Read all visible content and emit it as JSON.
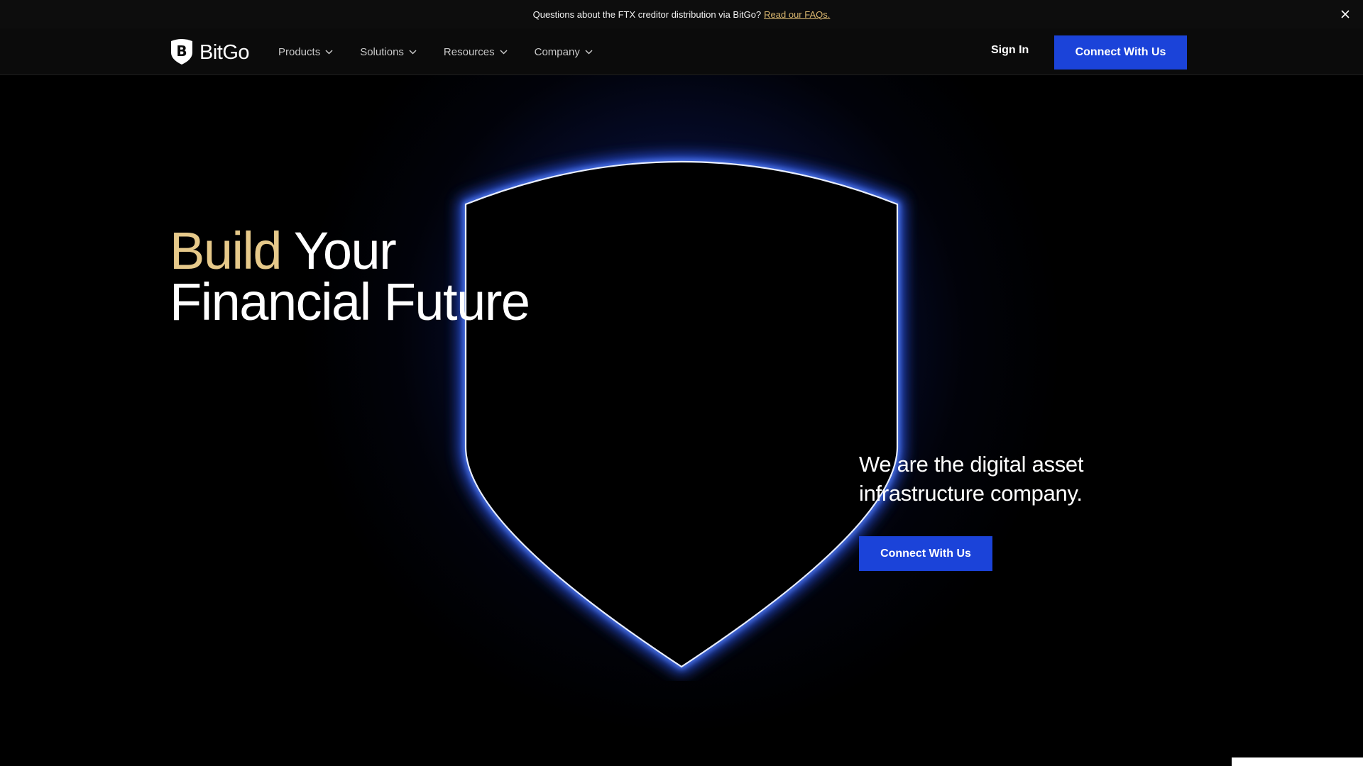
{
  "announcement": {
    "text": "Questions about the FTX creditor distribution via BitGo?",
    "link": "Read our FAQs.",
    "close_icon": "close-icon"
  },
  "nav": {
    "logo_text": "BitGo",
    "logo_icon": "bitcoin-shield-icon",
    "menu": [
      {
        "label": "Products",
        "icon": "chevron-down-icon"
      },
      {
        "label": "Solutions",
        "icon": "chevron-down-icon"
      },
      {
        "label": "Resources",
        "icon": "chevron-down-icon"
      },
      {
        "label": "Company",
        "icon": "chevron-down-icon"
      }
    ],
    "sign_in": "Sign In",
    "cta": "Connect With Us"
  },
  "hero": {
    "headline_accent": "Build",
    "headline_rest_line1": "Your",
    "headline_line2": "Financial Future",
    "tagline": "We are the digital asset infrastructure company.",
    "cta": "Connect With Us"
  },
  "colors": {
    "accent_blue": "#1b43d9",
    "gold": "#e6c98a",
    "background": "#000000"
  }
}
